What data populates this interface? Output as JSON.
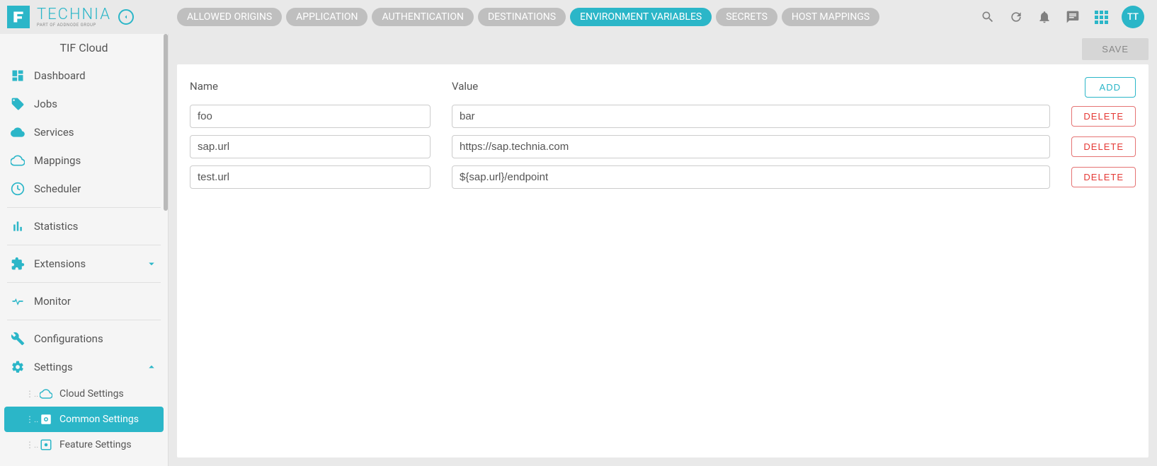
{
  "brand": {
    "name": "TECHNIA",
    "subtitle": "PART OF ADDNODE GROUP"
  },
  "appTitle": "TIF Cloud",
  "tabs": [
    {
      "label": "ALLOWED ORIGINS",
      "active": false
    },
    {
      "label": "APPLICATION",
      "active": false
    },
    {
      "label": "AUTHENTICATION",
      "active": false
    },
    {
      "label": "DESTINATIONS",
      "active": false
    },
    {
      "label": "ENVIRONMENT VARIABLES",
      "active": true
    },
    {
      "label": "SECRETS",
      "active": false
    },
    {
      "label": "HOST MAPPINGS",
      "active": false
    }
  ],
  "avatar": "TT",
  "sidebar": {
    "items": {
      "dashboard": "Dashboard",
      "jobs": "Jobs",
      "services": "Services",
      "mappings": "Mappings",
      "scheduler": "Scheduler",
      "statistics": "Statistics",
      "extensions": "Extensions",
      "monitor": "Monitor",
      "configurations": "Configurations",
      "settings": "Settings"
    },
    "settingsChildren": {
      "cloud": "Cloud Settings",
      "common": "Common Settings",
      "feature": "Feature Settings"
    }
  },
  "actions": {
    "save": "SAVE",
    "add": "ADD",
    "delete": "DELETE"
  },
  "columns": {
    "name": "Name",
    "value": "Value"
  },
  "rows": [
    {
      "name": "foo",
      "value": "bar"
    },
    {
      "name": "sap.url",
      "value": "https://sap.technia.com"
    },
    {
      "name": "test.url",
      "value": "${sap.url}/endpoint"
    }
  ]
}
